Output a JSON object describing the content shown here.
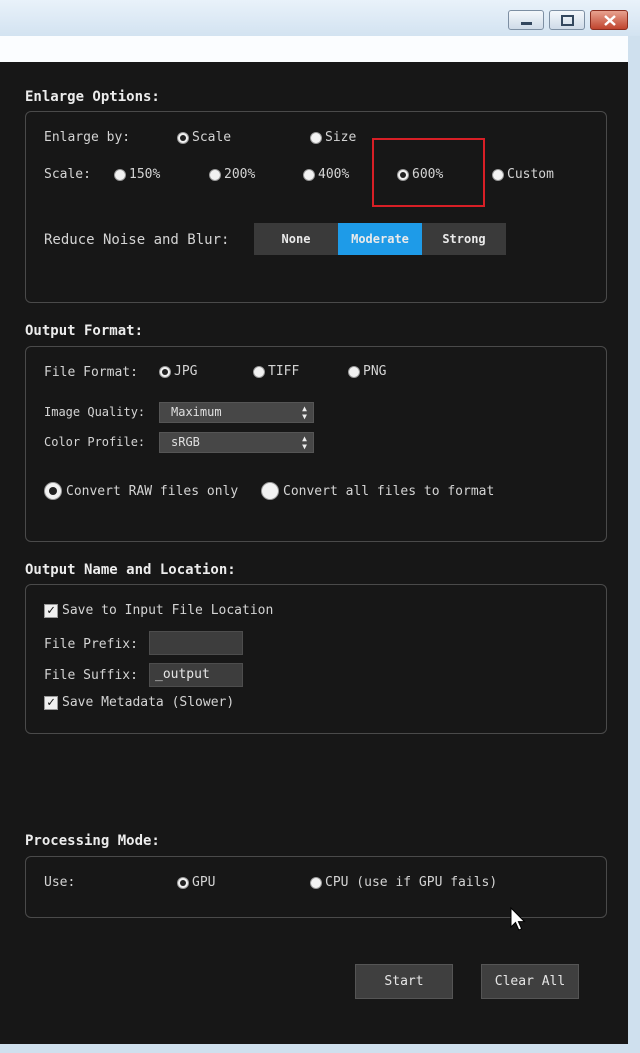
{
  "enlarge": {
    "title": "Enlarge Options:",
    "enlarge_by_label": "Enlarge by:",
    "enlarge_by_options": [
      "Scale",
      "Size"
    ],
    "scale_label": "Scale:",
    "scale_options": [
      "150%",
      "200%",
      "400%",
      "600%",
      "Custom"
    ],
    "noise_label": "Reduce Noise and Blur:",
    "noise_options": [
      "None",
      "Moderate",
      "Strong"
    ]
  },
  "output_format": {
    "title": "Output Format:",
    "file_format_label": "File Format:",
    "file_formats": [
      "JPG",
      "TIFF",
      "PNG"
    ],
    "image_quality_label": "Image Quality:",
    "image_quality_value": "Maximum",
    "color_profile_label": "Color Profile:",
    "color_profile_value": "sRGB",
    "convert_raw_label": "Convert RAW files only",
    "convert_all_label": "Convert all files to format"
  },
  "output_name": {
    "title": "Output Name and Location:",
    "save_input_location_label": "Save to Input File Location",
    "file_prefix_label": "File Prefix:",
    "file_prefix_value": "",
    "file_suffix_label": "File Suffix:",
    "file_suffix_value": "_output",
    "save_metadata_label": "Save Metadata (Slower)"
  },
  "processing": {
    "title": "Processing Mode:",
    "use_label": "Use:",
    "gpu_label": "GPU",
    "cpu_label": "CPU (use if GPU fails)"
  },
  "buttons": {
    "start": "Start",
    "clear_all": "Clear All"
  },
  "colors": {
    "accent": "#1e9be8",
    "highlight": "#d81f26",
    "panel_bg": "#171717"
  },
  "icons": [
    "minimize-icon",
    "maximize-icon",
    "close-icon",
    "chevron-updown-icon",
    "checkmark-icon",
    "mouse-pointer-icon"
  ]
}
